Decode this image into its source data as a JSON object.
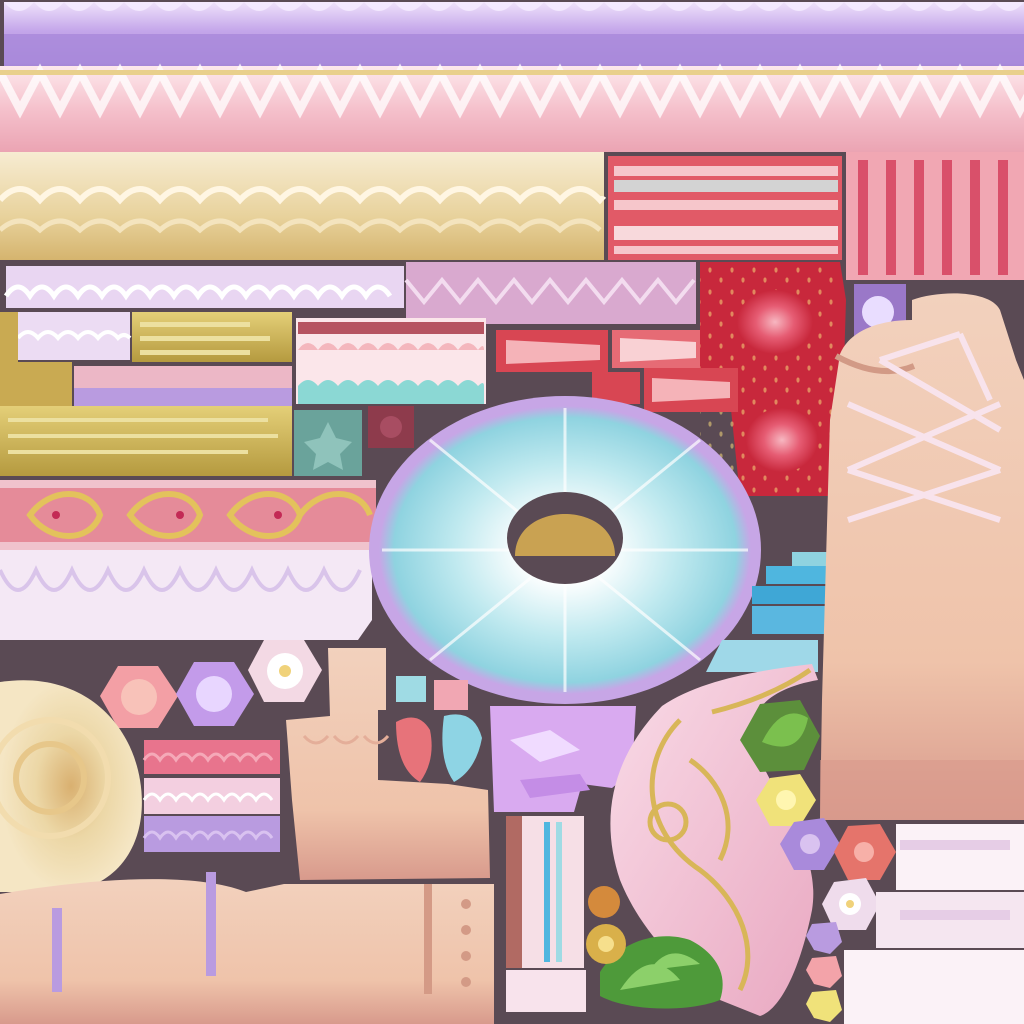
{
  "canvas": {
    "background": "#5a4a54"
  },
  "palette": {
    "lavender": "#b99be0",
    "lavender_light": "#d9c2f0",
    "pink_light": "#f3c9d4",
    "pink": "#e88fa3",
    "pink_deep": "#d9606f",
    "cream": "#ecd7a6",
    "gold": "#c9aa52",
    "strawberry_red": "#c8283c",
    "coral": "#e5746b",
    "skin": "#efc3aa",
    "skin_shadow": "#d8a091",
    "aqua": "#9fdbe4",
    "blue": "#5ab7e0",
    "teal": "#6aa39b",
    "leaf_green": "#4e9a3a",
    "yellow": "#f0e27a",
    "white_lace": "#fbf2f7"
  },
  "icons": [
    "rose-icon",
    "flower-icon",
    "leaf-icon",
    "strawberry-icon",
    "gem-icon",
    "wing-icon",
    "bead-icon",
    "star-icon"
  ]
}
